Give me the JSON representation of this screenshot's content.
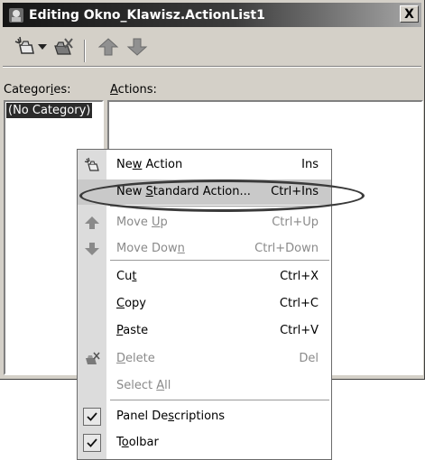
{
  "window": {
    "title": "Editing Okno_Klawisz.ActionList1",
    "close_glyph": "X"
  },
  "toolbar": {
    "icons": [
      "new-action-icon",
      "dropdown-arrow-icon",
      "delete-action-icon",
      "move-up-icon",
      "move-down-icon"
    ]
  },
  "labels": {
    "categories": {
      "pre": "Categor",
      "u": "i",
      "post": "es:"
    },
    "actions": {
      "pre": "",
      "u": "A",
      "post": "ctions:"
    }
  },
  "categories": [
    "(No Category)"
  ],
  "context_menu": {
    "items": [
      {
        "pre": "Ne",
        "u": "w",
        "post": " Action",
        "shortcut": "Ins",
        "icon": "new-action-icon",
        "disabled": false
      },
      {
        "pre": "New ",
        "u": "S",
        "post": "tandard Action...",
        "shortcut": "Ctrl+Ins",
        "icon": "",
        "disabled": false,
        "highlight": true
      },
      {
        "pre": "Move ",
        "u": "U",
        "post": "p",
        "shortcut": "Ctrl+Up",
        "icon": "move-up-icon",
        "disabled": true
      },
      {
        "pre": "Move Dow",
        "u": "n",
        "post": "",
        "shortcut": "Ctrl+Down",
        "icon": "move-down-icon",
        "disabled": true
      },
      {
        "pre": "Cu",
        "u": "t",
        "post": "",
        "shortcut": "Ctrl+X",
        "icon": "",
        "disabled": false
      },
      {
        "pre": "",
        "u": "C",
        "post": "opy",
        "shortcut": "Ctrl+C",
        "icon": "",
        "disabled": false
      },
      {
        "pre": "",
        "u": "P",
        "post": "aste",
        "shortcut": "Ctrl+V",
        "icon": "",
        "disabled": false
      },
      {
        "pre": "",
        "u": "D",
        "post": "elete",
        "shortcut": "Del",
        "icon": "delete-action-icon",
        "disabled": true
      },
      {
        "pre": "Select ",
        "u": "A",
        "post": "ll",
        "shortcut": "",
        "icon": "",
        "disabled": true
      },
      {
        "pre": "Panel De",
        "u": "s",
        "post": "criptions",
        "shortcut": "",
        "icon": "check-icon",
        "disabled": false,
        "checked": true
      },
      {
        "pre": "T",
        "u": "o",
        "post": "olbar",
        "shortcut": "",
        "icon": "check-icon",
        "disabled": false,
        "checked": true
      }
    ]
  },
  "colors": {
    "title_dark": "#151515",
    "face": "#d4d0c8",
    "menu_highlight": "#c9c9c9",
    "disabled_text": "#8a8a8a"
  }
}
